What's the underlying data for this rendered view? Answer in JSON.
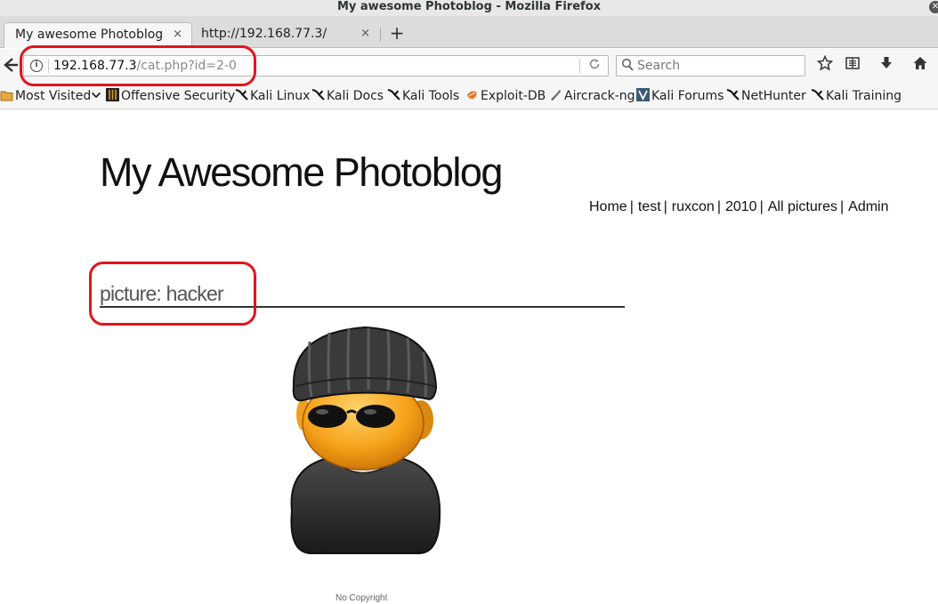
{
  "window": {
    "title": "My awesome Photoblog - Mozilla Firefox"
  },
  "tabs": [
    {
      "label": "My awesome Photoblog",
      "close": "×"
    },
    {
      "label": "http://192.168.77.3/",
      "close": "×"
    }
  ],
  "new_tab_label": "+",
  "url": {
    "host": "192.168.77.3",
    "path": "/cat.php?id=2-0"
  },
  "search": {
    "placeholder": "Search"
  },
  "bookmarks": [
    {
      "label": "Most Visited",
      "icon": "folder-icon"
    },
    {
      "label": "Offensive Security",
      "icon": "offsec-icon"
    },
    {
      "label": "Kali Linux",
      "icon": "kali-dragon-icon"
    },
    {
      "label": "Kali Docs",
      "icon": "kali-dragon-icon"
    },
    {
      "label": "Kali Tools",
      "icon": "kali-dragon-icon"
    },
    {
      "label": "Exploit-DB",
      "icon": "exploitdb-icon"
    },
    {
      "label": "Aircrack-ng",
      "icon": "aircrack-icon"
    },
    {
      "label": "Kali Forums",
      "icon": "forums-icon"
    },
    {
      "label": "NetHunter",
      "icon": "kali-dragon-icon"
    },
    {
      "label": "Kali Training",
      "icon": "kali-dragon-icon"
    }
  ],
  "page": {
    "title": "My Awesome Photoblog",
    "menu": [
      "Home",
      "test",
      "ruxcon",
      "2010",
      "All pictures",
      "Admin"
    ],
    "menu_separator": "|",
    "picture_heading": "picture: hacker",
    "footer": "No Copyright"
  },
  "colors": {
    "annotation": "#e3131b",
    "chrome": "#f6f6f6"
  }
}
